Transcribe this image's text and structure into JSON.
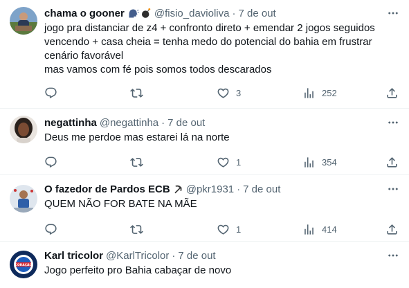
{
  "tweets": [
    {
      "name": "chama o gooner",
      "name_emojis": [
        "speaking-head-emoji",
        "bomb-emoji"
      ],
      "handle": "@fisio_davioliva",
      "separator": "·",
      "date": "7 de out",
      "lines": [
        "jogo pra distanciar de z4 + confronto direto + emendar 2 jogos seguidos",
        "vencendo + casa cheia = tenha medo do potencial do bahia em frustrar",
        "cenário favorável",
        "mas vamos com fé pois somos todos descarados"
      ],
      "likes": "3",
      "views": "252"
    },
    {
      "name": "negattinha",
      "handle": "@negattinha",
      "separator": "·",
      "date": "7 de out",
      "lines": [
        "Deus me perdoe mas estarei lá na norte"
      ],
      "likes": "1",
      "views": "354"
    },
    {
      "name": "O fazedor de Pardos ECB",
      "name_emojis": [
        "hammer-and-sickle-emoji"
      ],
      "handle": "@pkr1931",
      "separator": "·",
      "date": "7 de out",
      "lines": [
        "QUEM NÃO FOR BATE NA MÃE"
      ],
      "likes": "1",
      "views": "414"
    },
    {
      "name": "Karl tricolor",
      "handle": "@KarlTricolor",
      "separator": "·",
      "date": "7 de out",
      "lines": [
        "Jogo perfeito pro Bahia cabaçar de novo"
      ],
      "avatar_text": "CORAÇÃO"
    }
  ],
  "colors": {
    "text_primary": "#0f1419",
    "text_secondary": "#536471",
    "divider": "#eff3f4"
  },
  "icons": {
    "reply": "reply-icon",
    "retweet": "retweet-icon",
    "like": "heart-icon",
    "views": "views-icon",
    "share": "share-icon",
    "more": "more-icon"
  }
}
